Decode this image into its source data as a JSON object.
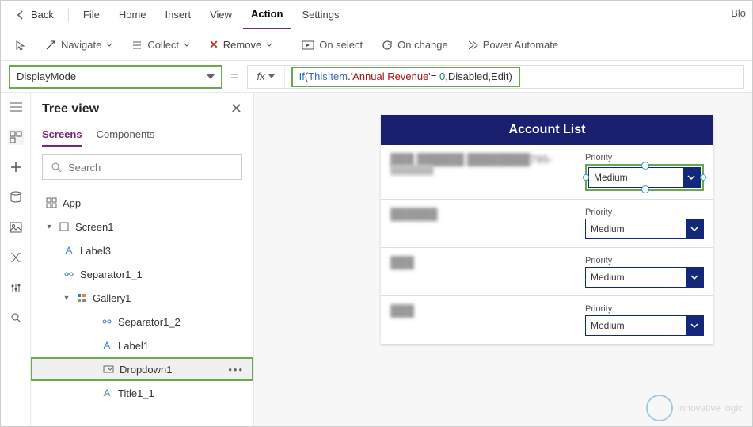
{
  "top_menu": {
    "back": "Back",
    "items": [
      "File",
      "Home",
      "Insert",
      "View",
      "Action",
      "Settings"
    ],
    "right": "Blo"
  },
  "ribbon": {
    "navigate": "Navigate",
    "collect": "Collect",
    "remove": "Remove",
    "onselect": "On select",
    "onchange": "On change",
    "power_automate": "Power Automate"
  },
  "property_dropdown": "DisplayMode",
  "formula": {
    "fn": "If",
    "op1": "ThisItem",
    "str": "'Annual Revenue'",
    "eq": "=",
    "num": "0",
    "args": ",Disabled,Edit)"
  },
  "tree": {
    "title": "Tree view",
    "tabs": [
      "Screens",
      "Components"
    ],
    "search_placeholder": "Search",
    "app": "App",
    "screen1": "Screen1",
    "label3": "Label3",
    "sep11": "Separator1_1",
    "gallery1": "Gallery1",
    "sep12": "Separator1_2",
    "label1": "Label1",
    "dropdown1": "Dropdown1",
    "title11": "Title1_1"
  },
  "app": {
    "header": "Account List",
    "rows": [
      {
        "title": "███ ██████ ████████795-",
        "sub": "███████",
        "priority_label": "Priority",
        "value": "Medium",
        "selected": true
      },
      {
        "title": "██████",
        "sub": "",
        "priority_label": "Priority",
        "value": "Medium",
        "selected": false
      },
      {
        "title": "███",
        "sub": "",
        "priority_label": "Priority",
        "value": "Medium",
        "selected": false
      },
      {
        "title": "███",
        "sub": "",
        "priority_label": "Priority",
        "value": "Medium",
        "selected": false
      }
    ]
  },
  "logo_text": "innovative logic"
}
